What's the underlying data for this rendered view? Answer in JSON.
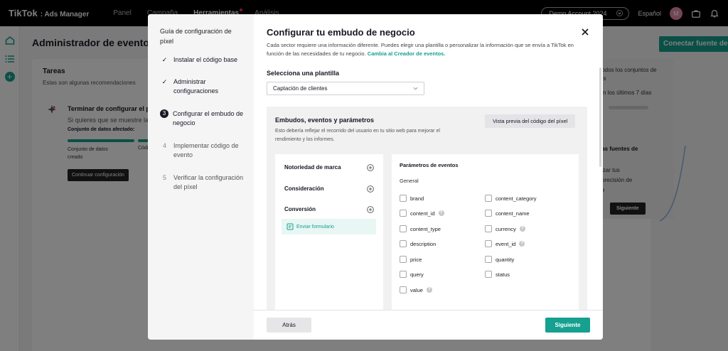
{
  "topnav": {
    "brand_main": "TikTok",
    "brand_sub": ": Ads Manager",
    "links": [
      "Panel",
      "Campaña",
      "Herramientas",
      "Análisis"
    ],
    "account": "Demo Account 2024",
    "language": "Español",
    "avatar_initial": "M"
  },
  "background": {
    "title": "Administrador de eventos",
    "connect_button": "Conectar fuente de da",
    "tasks": {
      "title": "Tareas",
      "subtitle": "Estas son algunas recomendaciones",
      "item_title": "Terminar de configurar el pí",
      "item_desc": "Si quieres que se muestre la",
      "item_data": "Conjunto de datos afectado:",
      "step1_line1": "Conjunto de datos",
      "step1_line2": "creado",
      "step2": "Códi",
      "button": "Continuar configuración"
    },
    "right_panel": {
      "line1": "todos los conjuntos de",
      "line2": "os",
      "line3": "n los últimos 7 días",
      "title": "las fuentes de",
      "line4": "izar tus",
      "line5": "precisión de",
      "line6": "e",
      "button": "Siguiente"
    }
  },
  "modal": {
    "side": {
      "title": "Guía de configuración de píxel",
      "steps": [
        {
          "mark": "✓",
          "label": "Instalar el código base"
        },
        {
          "mark": "✓",
          "label": "Administrar configuraciones"
        },
        {
          "mark": "3",
          "label": "Configurar el embudo de negocio"
        },
        {
          "mark": "4",
          "label": "Implementar código de evento"
        },
        {
          "mark": "5",
          "label": "Verificar la configuración del píxel"
        }
      ]
    },
    "title": "Configurar tu embudo de negocio",
    "description": "Cada sector requiere una información diferente. Puedes elegir una plantilla o personalizar la información que se envía a TikTok en función de las necesidades de tu negocio.",
    "description_link": "Cambia al Creador de eventos.",
    "template_label": "Selecciona una plantilla",
    "template_value": "Captación de clientes",
    "funnel": {
      "title": "Embudos, eventos y parámetros",
      "description": "Esto debería reflejar el recorrido del usuario en tu sitio web para mejorar el rendimiento y los informes.",
      "preview_button": "Vista previa del código del píxel",
      "stages": [
        "Notoriedad de marca",
        "Consideración",
        "Conversión"
      ],
      "event": "Enviar formulario"
    },
    "params": {
      "title": "Parámetros de eventos",
      "group": "General",
      "items": [
        {
          "label": "brand",
          "info": false
        },
        {
          "label": "content_category",
          "info": false
        },
        {
          "label": "content_id",
          "info": true
        },
        {
          "label": "content_name",
          "info": false
        },
        {
          "label": "content_type",
          "info": false
        },
        {
          "label": "currency",
          "info": true
        },
        {
          "label": "description",
          "info": false
        },
        {
          "label": "event_id",
          "info": true
        },
        {
          "label": "price",
          "info": false
        },
        {
          "label": "quantity",
          "info": false
        },
        {
          "label": "query",
          "info": false
        },
        {
          "label": "status",
          "info": false
        },
        {
          "label": "value",
          "info": true
        }
      ]
    },
    "footer": {
      "back": "Atrás",
      "next": "Siguiente"
    }
  },
  "colors": {
    "accent": "#15a08f",
    "brand_dot": "#fe2c55"
  }
}
